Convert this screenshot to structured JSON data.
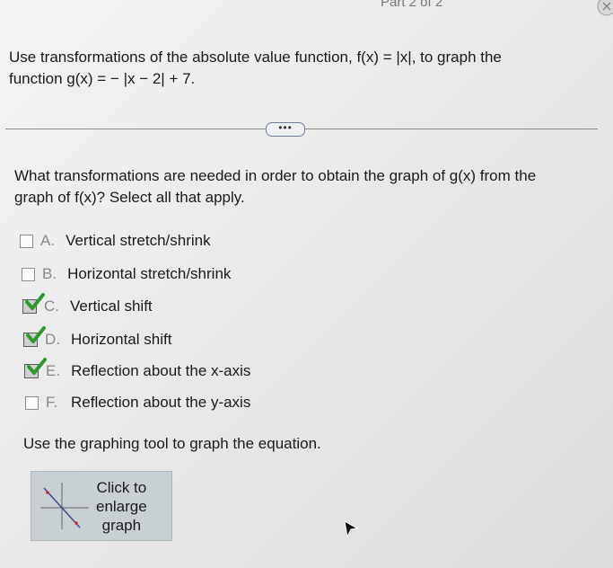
{
  "header": {
    "part_label": "Part 2 of 2"
  },
  "question": {
    "line1": "Use transformations of the absolute value function, f(x) = |x|, to graph the",
    "line2": "function g(x) = − |x − 2| + 7."
  },
  "more_button": {
    "label": "•••"
  },
  "prompt": {
    "line1": "What transformations are needed in order to obtain the graph of g(x) from the",
    "line2": "graph of f(x)? Select all that apply."
  },
  "options": [
    {
      "letter": "A.",
      "label": "Vertical stretch/shrink",
      "checked": false
    },
    {
      "letter": "B.",
      "label": "Horizontal stretch/shrink",
      "checked": false
    },
    {
      "letter": "C.",
      "label": "Vertical shift",
      "checked": true
    },
    {
      "letter": "D.",
      "label": "Horizontal shift",
      "checked": true
    },
    {
      "letter": "E.",
      "label": "Reflection about the x-axis",
      "checked": true
    },
    {
      "letter": "F.",
      "label": "Reflection about the y-axis",
      "checked": false
    }
  ],
  "instruction": "Use the graphing tool to graph the equation.",
  "graph_thumbnail": {
    "line1": "Click to",
    "line2": "enlarge",
    "line3": "graph"
  },
  "colors": {
    "check": "#2e9a2e",
    "divider": "#8a8a8a",
    "button_border": "#6e7e94"
  }
}
